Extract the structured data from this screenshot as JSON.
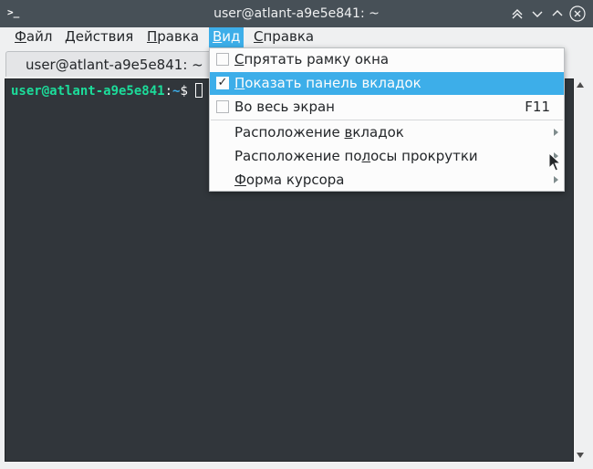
{
  "window": {
    "title": "user@atlant-a9e5e841: ~",
    "app_icon": ">_",
    "buttons": [
      "keep-above",
      "minimize",
      "maximize",
      "close"
    ]
  },
  "menubar": {
    "items": [
      {
        "label": "Файл",
        "accel": "Ф",
        "rest": "айл"
      },
      {
        "label": "Действия",
        "accel": "Д",
        "rest": "ействия"
      },
      {
        "label": "Правка",
        "accel": "П",
        "rest": "равка"
      },
      {
        "label": "Вид",
        "accel": "В",
        "rest": "ид",
        "active": true
      },
      {
        "label": "Справка",
        "accel": "С",
        "rest": "правка"
      }
    ]
  },
  "tabs": [
    {
      "label": "user@atlant-a9e5e841: ~",
      "active": true
    }
  ],
  "terminal": {
    "user_host": "user@atlant-a9e5e841",
    "colon": ":",
    "path": "~",
    "prompt_char": "$ "
  },
  "view_menu": {
    "items": [
      {
        "label": "Спрятать рамку окна",
        "accel": "С",
        "rest": "прятать рамку окна",
        "checkable": true,
        "checked": false
      },
      {
        "label": "Показать панель вкладок",
        "accel": "П",
        "rest": "оказать панель вкладок",
        "checkable": true,
        "checked": true,
        "highlighted": true
      },
      {
        "label": "Во весь экран",
        "checkable": true,
        "checked": false,
        "shortcut": "F11"
      },
      {
        "label": "Расположение вкладок",
        "pre": "Расположение ",
        "accel": "в",
        "rest": "кладок",
        "submenu": true
      },
      {
        "label": "Расположение полосы прокрутки",
        "pre": "Расположение по",
        "accel": "л",
        "rest": "осы прокрутки",
        "submenu": true
      },
      {
        "label": "Форма курсора",
        "accel": "Ф",
        "rest": "орма курсора",
        "submenu": true
      }
    ]
  },
  "colors": {
    "titlebar": "#475057",
    "accent": "#3daee9",
    "terminal_bg": "#31363b",
    "prompt_user": "#1cdc9a",
    "prompt_path": "#3daee9"
  }
}
